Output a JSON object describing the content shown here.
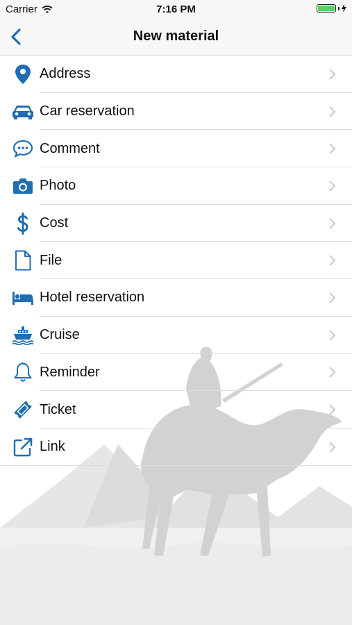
{
  "status_bar": {
    "carrier": "Carrier",
    "time": "7:16 PM",
    "battery_level": 1.0
  },
  "nav": {
    "title": "New material",
    "back_icon": "chevron-left-icon"
  },
  "colors": {
    "accent": "#1f6db3",
    "chevron": "#c7c7cc",
    "separator": "#dcdcdc",
    "battery": "#4cd964"
  },
  "items": [
    {
      "label": "Address",
      "icon": "map-pin-icon"
    },
    {
      "label": "Car reservation",
      "icon": "car-icon"
    },
    {
      "label": "Comment",
      "icon": "speech-bubble-icon"
    },
    {
      "label": "Photo",
      "icon": "camera-icon"
    },
    {
      "label": "Cost",
      "icon": "dollar-icon"
    },
    {
      "label": "File",
      "icon": "file-icon"
    },
    {
      "label": "Hotel reservation",
      "icon": "bed-icon"
    },
    {
      "label": "Cruise",
      "icon": "ship-icon"
    },
    {
      "label": "Reminder",
      "icon": "bell-icon"
    },
    {
      "label": "Ticket",
      "icon": "ticket-icon"
    },
    {
      "label": "Link",
      "icon": "external-link-icon"
    }
  ]
}
